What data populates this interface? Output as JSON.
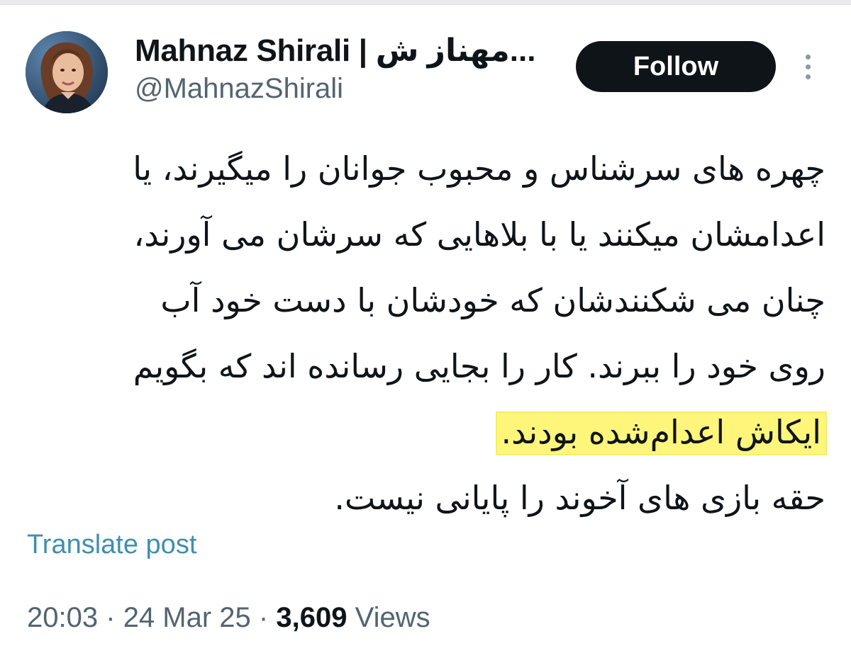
{
  "author": {
    "display_name": "Mahnaz Shirali | مهناز ش...",
    "handle": "@MahnazShirali"
  },
  "actions": {
    "follow_label": "Follow"
  },
  "tweet": {
    "lines": [
      "چهره های سرشناس و محبوب جوانان را میگیرند، یا",
      "اعدامشان میکنند یا با بلاهایی که سرشان می آورند،",
      "چنان می شکنندشان که خودشان با دست خود آب",
      "روی خود را ببرند. کار را بجایی رسانده اند که بگویم",
      "ایکاش اعدام‌شده بودند.",
      "حقه بازی های آخوند را پایانی نیست."
    ]
  },
  "translate_label": "Translate post",
  "meta": {
    "time": "20:03",
    "date": "24 Mar 25",
    "separator": "·",
    "views_count": "3,609",
    "views_label": "Views"
  },
  "colors": {
    "follow_bg": "#0f1419",
    "link": "#3f8fae",
    "highlight": "#fdf67a",
    "secondary_text": "#536471"
  },
  "icons": {
    "more": "more-vertical-icon",
    "avatar": "profile-photo"
  }
}
